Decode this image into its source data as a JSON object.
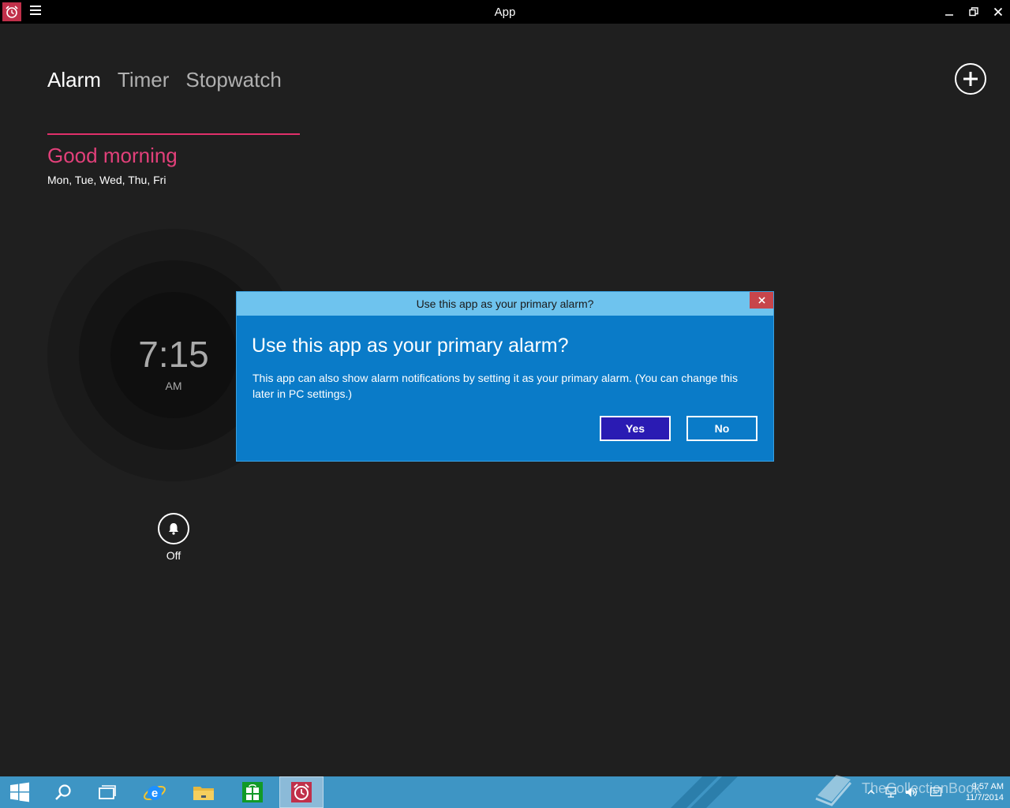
{
  "window": {
    "title": "App",
    "minimize_glyph": "–",
    "maximize_glyph": "⧉",
    "close_glyph": "✕"
  },
  "tabs": [
    {
      "label": "Alarm",
      "active": true
    },
    {
      "label": "Timer",
      "active": false
    },
    {
      "label": "Stopwatch",
      "active": false
    }
  ],
  "alarm": {
    "name": "Good morning",
    "days": "Mon, Tue, Wed, Thu, Fri",
    "time": "7:15",
    "ampm": "AM",
    "state_label": "Off"
  },
  "dialog": {
    "title": "Use this app as your primary alarm?",
    "heading": "Use this app as your primary alarm?",
    "body": "This app can also show alarm notifications by setting it as your primary alarm. (You can change this later in PC settings.)",
    "yes_label": "Yes",
    "no_label": "No",
    "close_glyph": "✕"
  },
  "taskbar": {
    "clock_time": "9:57 AM",
    "clock_date": "11/7/2014",
    "watermark": "TheCollectionBook"
  },
  "colors": {
    "accent_pink": "#e2407a",
    "dialog_blue": "#0a7bc8",
    "dialog_title_blue": "#6ec3ee",
    "yes_button": "#2a1bb3",
    "taskbar": "#3e95c4"
  },
  "icons": {
    "app": "alarm-clock-icon",
    "menu": "hamburger-icon",
    "add": "plus-icon",
    "alarm_toggle": "bell-icon",
    "taskbar": [
      "windows-start-icon",
      "search-icon",
      "task-view-icon",
      "internet-explorer-icon",
      "file-explorer-icon",
      "store-icon",
      "alarms-app-icon"
    ],
    "tray": [
      "show-hidden-icons-chevron-icon",
      "network-icon",
      "volume-icon",
      "action-center-icon"
    ]
  }
}
